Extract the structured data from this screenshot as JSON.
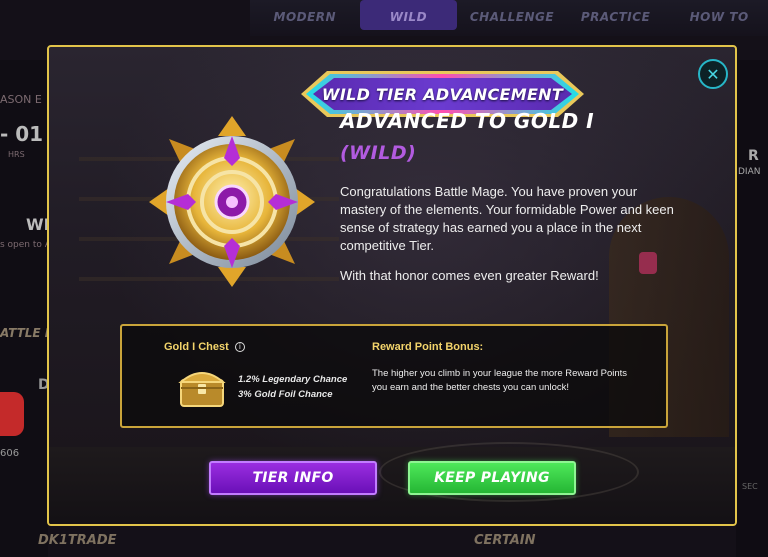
{
  "background": {
    "tabs": [
      "MODERN",
      "WILD",
      "CHALLENGE",
      "PRACTICE",
      "HOW TO"
    ],
    "active_tab": "WILD",
    "season_label": "ASON E",
    "timer": "- 01 :",
    "timer_unit": "HRS",
    "wild_label": "WI",
    "open_text": "s open to A",
    "battle_log_label": "ATTLE LO",
    "side_letter": "D",
    "side_number": "606",
    "right_label": "R",
    "right_sub": "DIAN",
    "bottom_left": "DK1TRADE",
    "bottom_center": "CERTAIN",
    "right_small": "SEC"
  },
  "modal": {
    "banner": "WILD TIER ADVANCEMENT",
    "close_icon": "close-x-icon",
    "heading": "ADVANCED TO GOLD I",
    "subheading": "(WILD)",
    "body": "Congratulations Battle Mage. You have proven your mastery of the elements. Your formidable Power and keen sense of strategy has earned you a place in the next competitive Tier.",
    "body2": "With that honor comes even greater Reward!",
    "emblem_icon": "gold-tier-emblem-icon",
    "reward": {
      "chest_title": "Gold I Chest",
      "chest_icon": "gold-chest-icon",
      "legendary": "1.2% Legendary Chance",
      "gold_foil": "3% Gold Foil Chance",
      "bonus_title": "Reward Point Bonus:",
      "bonus_text": "The higher you climb in your league the more Reward Points you earn and the better chests you can unlock!"
    },
    "buttons": {
      "tier_info": "TIER INFO",
      "keep_playing": "KEEP PLAYING"
    }
  },
  "colors": {
    "accent_gold": "#e2c44a",
    "wild_purple": "#b25be0",
    "button_purple": "#8a22d8",
    "button_green": "#3bd647",
    "close_cyan": "#27b6c7"
  }
}
